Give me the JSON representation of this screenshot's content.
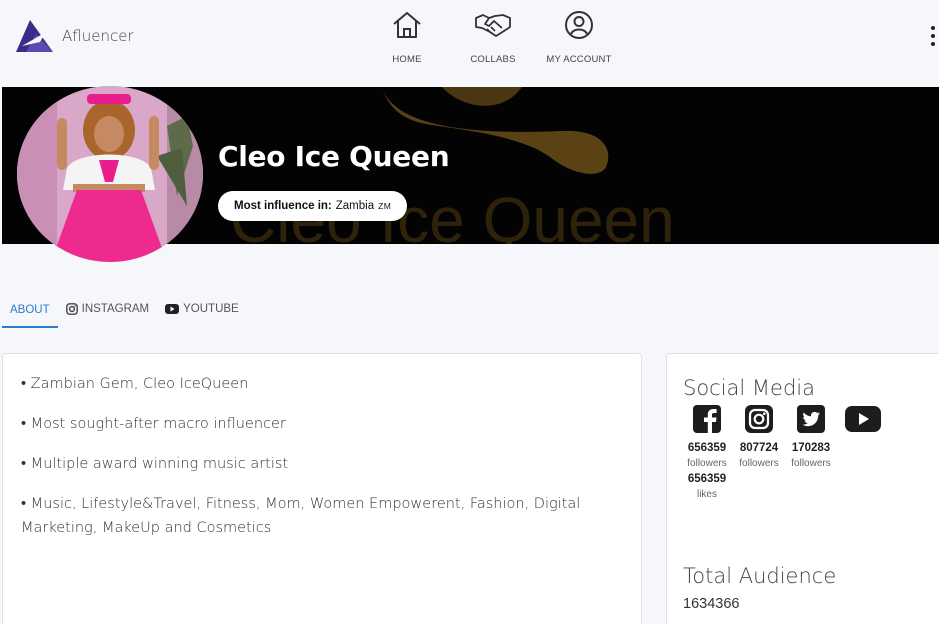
{
  "brand": {
    "name": "Afluencer"
  },
  "nav": {
    "items": [
      {
        "label": "HOME",
        "icon": "home-icon"
      },
      {
        "label": "COLLABS",
        "icon": "handshake-icon"
      },
      {
        "label": "MY ACCOUNT",
        "icon": "user-circle-icon"
      }
    ]
  },
  "profile": {
    "name": "Cleo Ice Queen",
    "banner_text": "Cleo Ice Queen",
    "influence_label": "Most influence in:",
    "influence_country": "Zambia",
    "influence_code": "ZM"
  },
  "tabs": [
    {
      "label": "ABOUT",
      "active": true
    },
    {
      "label": "INSTAGRAM",
      "icon": "instagram-icon"
    },
    {
      "label": "YOUTUBE",
      "icon": "youtube-icon"
    }
  ],
  "about": {
    "lines": [
      "• Zambian Gem, Cleo IceQueen",
      "• Most sought-after macro influencer",
      "• Multiple award winning music artist",
      "• Music, Lifestyle&Travel, Fitness, Mom, Women Empowerent, Fashion, Digital Marketing, MakeUp and Cosmetics"
    ]
  },
  "social": {
    "title": "Social Media",
    "items": [
      {
        "network": "facebook-icon",
        "count": "656359",
        "unit": "followers"
      },
      {
        "network": "instagram-icon",
        "count": "807724",
        "unit": "followers"
      },
      {
        "network": "twitter-icon",
        "count": "170283",
        "unit": "followers"
      },
      {
        "network": "youtube-icon",
        "count": "656359",
        "unit": "likes"
      }
    ]
  },
  "audience": {
    "title": "Total Audience",
    "value": "1634366"
  },
  "colors": {
    "accent": "#2a7dc9",
    "brand": "#3b2c8a",
    "banner_gold": "#6b4e17",
    "banner_bg": "#030303"
  }
}
